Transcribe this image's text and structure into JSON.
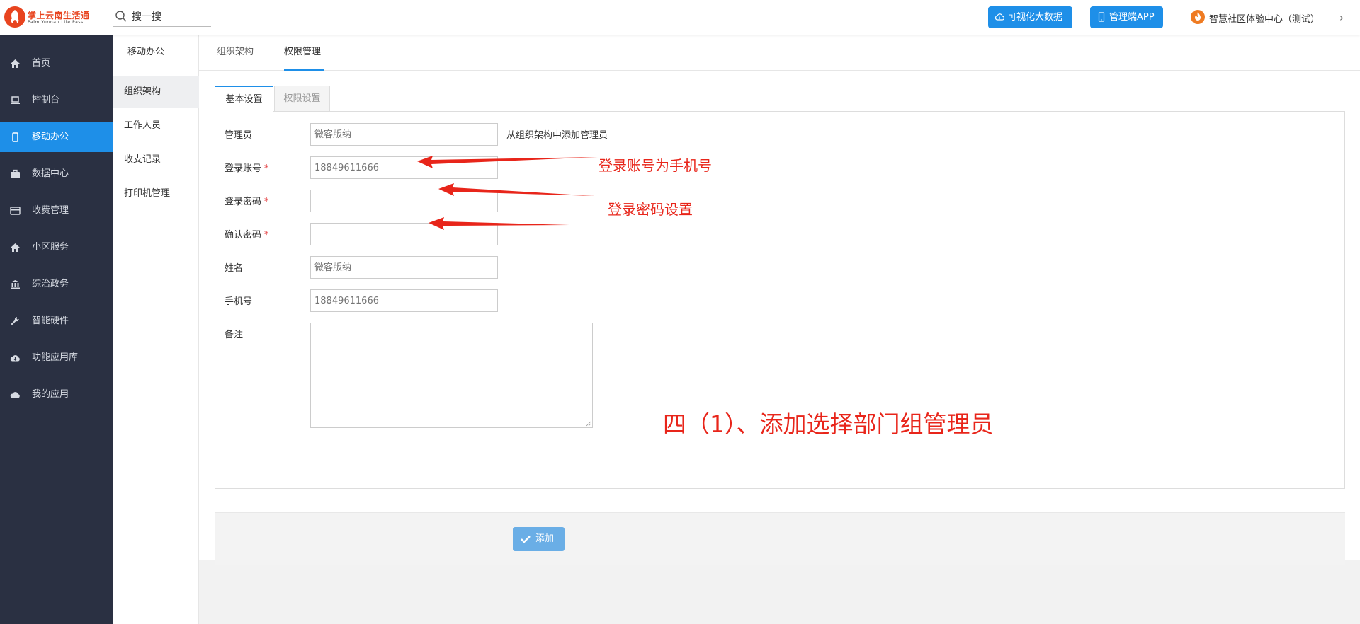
{
  "header": {
    "logo_title": "掌上云南生活通",
    "logo_subtitle": "Palm Yunnan Life Pass",
    "search_label": "搜一搜",
    "bigdata_button": "可视化大数据",
    "app_button": "管理端APP",
    "site_name": "智慧社区体验中心（测试）",
    "site_chevron": "›"
  },
  "sidebar": {
    "items": [
      {
        "label": "首页",
        "icon": "home-icon"
      },
      {
        "label": "控制台",
        "icon": "laptop-icon"
      },
      {
        "label": "移动办公",
        "icon": "mobile-icon",
        "active": true
      },
      {
        "label": "数据中心",
        "icon": "briefcase-icon"
      },
      {
        "label": "收费管理",
        "icon": "credit-card-icon"
      },
      {
        "label": "小区服务",
        "icon": "home-icon"
      },
      {
        "label": "综治政务",
        "icon": "bank-icon"
      },
      {
        "label": "智能硬件",
        "icon": "wrench-icon"
      },
      {
        "label": "功能应用库",
        "icon": "cloud-download-icon"
      },
      {
        "label": "我的应用",
        "icon": "cloud-icon"
      }
    ]
  },
  "subnav": {
    "title": "移动办公",
    "items": [
      {
        "label": "组织架构",
        "active": true
      },
      {
        "label": "工作人员"
      },
      {
        "label": "收支记录"
      },
      {
        "label": "打印机管理"
      }
    ]
  },
  "tabs": {
    "top": [
      "组织架构",
      "权限管理"
    ],
    "active_top": "权限管理",
    "inner": [
      "基本设置",
      "权限设置"
    ],
    "active_inner": "基本设置"
  },
  "form": {
    "admin": {
      "label": "管理员",
      "placeholder": "微客版纳",
      "hint": "从组织架构中添加管理员"
    },
    "account": {
      "label": "登录账号",
      "required_mark": "*",
      "placeholder": "18849611666"
    },
    "password": {
      "label": "登录密码",
      "required_mark": "*",
      "placeholder": ""
    },
    "confirm": {
      "label": "确认密码",
      "required_mark": "*",
      "placeholder": ""
    },
    "name": {
      "label": "姓名",
      "placeholder": "微客版纳"
    },
    "phone": {
      "label": "手机号",
      "placeholder": "18849611666"
    },
    "remark": {
      "label": "备注"
    }
  },
  "annotations": {
    "account_note": "登录账号为手机号",
    "password_note": "登录密码设置",
    "step_title": "四（1）、添加选择部门组管理员",
    "color": "#e8251a"
  },
  "actions": {
    "add_button": "添加"
  },
  "colors": {
    "sidebar_bg": "#2a3042",
    "accent": "#1e8fe8",
    "add_button_bg": "#6aaee6"
  }
}
